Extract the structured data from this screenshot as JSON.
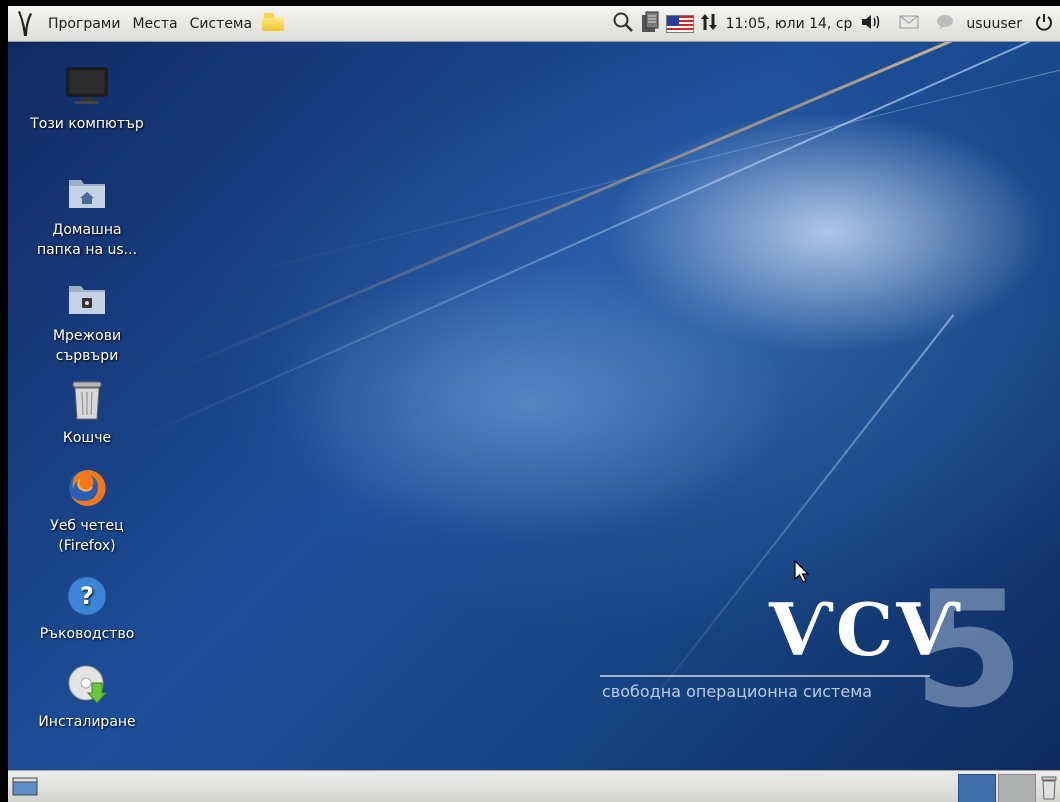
{
  "top_panel": {
    "logo_icon": "distro-logo-icon",
    "menus": [
      "Програми",
      "Места",
      "Система"
    ],
    "notes_icon": "folder-notes-icon",
    "tray": {
      "search_icon": "search-icon",
      "clipboard_icon": "clipboard-icon",
      "keyboard_layout_icon": "us-flag-icon",
      "network_icon": "network-updown-icon",
      "clock": "11:05, юли 14, ср",
      "volume_icon": "volume-icon",
      "mail_icon": "mail-icon",
      "chat_icon": "chat-status-icon",
      "user": "usuuser",
      "power_icon": "power-icon"
    }
  },
  "desktop": {
    "icons": [
      {
        "label": "Този компютър",
        "icon": "computer-icon"
      },
      {
        "label": "Домашна папка на us...",
        "icon": "home-folder-icon"
      },
      {
        "label": "Мрежови сървъри",
        "icon": "network-folder-icon"
      },
      {
        "label": "Кошче",
        "icon": "trash-icon"
      },
      {
        "label": "Уеб четец (Firefox)",
        "icon": "firefox-icon"
      },
      {
        "label": "Ръководство",
        "icon": "help-icon"
      },
      {
        "label": "Инсталиране",
        "icon": "install-disc-icon"
      }
    ],
    "brand": {
      "letters": "ѴСѴ",
      "number": "5",
      "tagline": "свободна операционна система"
    }
  },
  "bottom_panel": {
    "show_desktop_icon": "show-desktop-icon",
    "workspaces": [
      "workspace-1",
      "workspace-2"
    ],
    "trash_applet_icon": "trash-applet-icon"
  },
  "colors": {
    "desktop_dark": "#112a63",
    "desktop_mid": "#1e4f9a",
    "panel": "#e6e6e3",
    "workspace_active": "#3f6eab"
  }
}
